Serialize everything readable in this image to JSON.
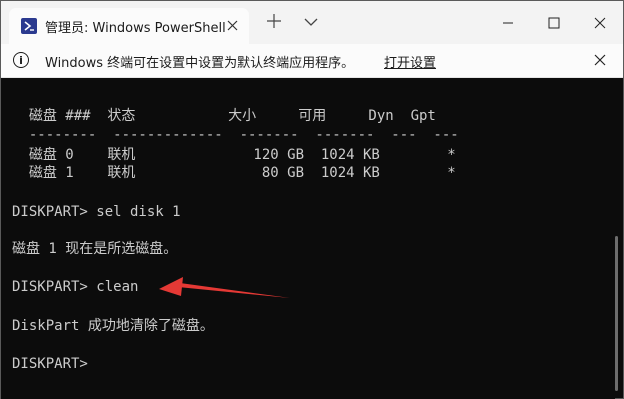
{
  "window": {
    "tab_title": "管理员: Windows PowerShell",
    "icons": [
      "powershell-icon",
      "tab-close-icon",
      "new-tab-icon",
      "chevron-down-icon",
      "minimize-icon",
      "maximize-icon",
      "close-icon"
    ]
  },
  "infobar": {
    "message": "Windows 终端可在设置中设置为默认终端应用程序。",
    "link": "打开设置"
  },
  "terminal": {
    "lines": [
      "  磁盘 ###  状态           大小     可用     Dyn  Gpt",
      "  --------  -------------  -------  -------  ---  ---",
      "  磁盘 0    联机              120 GB  1024 KB        *",
      "  磁盘 1    联机               80 GB  1024 KB        *",
      "DISKPART> sel disk 1",
      "磁盘 1 现在是所选磁盘。",
      "DISKPART> clean",
      "DiskPart 成功地清除了磁盘。",
      "DISKPART>"
    ]
  },
  "colors": {
    "terminal_bg": "#0c0c0c",
    "terminal_text": "#cccccc",
    "annotation_arrow": "#e53935"
  }
}
